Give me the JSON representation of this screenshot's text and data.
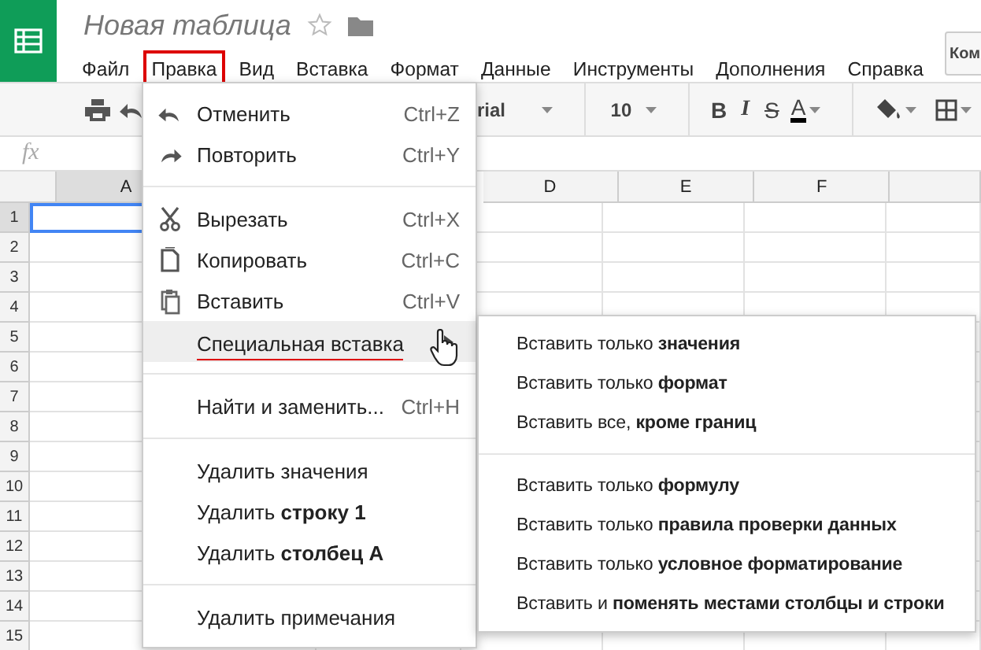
{
  "app": {
    "title": "Новая таблица",
    "starred": false
  },
  "menubar": [
    {
      "label": "Файл",
      "annotated": false
    },
    {
      "label": "Правка",
      "annotated": true
    },
    {
      "label": "Вид",
      "annotated": false
    },
    {
      "label": "Вставка",
      "annotated": false
    },
    {
      "label": "Формат",
      "annotated": false
    },
    {
      "label": "Данные",
      "annotated": false
    },
    {
      "label": "Инструменты",
      "annotated": false
    },
    {
      "label": "Дополнения",
      "annotated": false
    },
    {
      "label": "Справка",
      "annotated": false
    }
  ],
  "top_button": {
    "label": "Ком"
  },
  "toolbar": {
    "font": "rial",
    "font_size": "10",
    "format_buttons": [
      {
        "label": "B",
        "kind": "bold"
      },
      {
        "label": "I",
        "kind": "italic"
      },
      {
        "label": "S",
        "kind": "strike"
      },
      {
        "label": "A",
        "kind": "color"
      }
    ]
  },
  "formula_bar": {
    "label": "fx"
  },
  "columns": [
    {
      "label": "A",
      "selected": true
    },
    {
      "label": "D",
      "selected": false
    },
    {
      "label": "E",
      "selected": false
    },
    {
      "label": "F",
      "selected": false
    },
    {
      "selected": false
    }
  ],
  "rows": [
    {
      "label": "1",
      "selected": true
    },
    {
      "label": "2",
      "selected": false
    },
    {
      "label": "3",
      "selected": false
    },
    {
      "label": "4",
      "selected": false
    },
    {
      "label": "5",
      "selected": false
    },
    {
      "label": "6",
      "selected": false
    },
    {
      "label": "7",
      "selected": false
    },
    {
      "label": "8",
      "selected": false
    },
    {
      "label": "9",
      "selected": false
    },
    {
      "label": "10",
      "selected": false
    },
    {
      "label": "11",
      "selected": false
    },
    {
      "label": "12",
      "selected": false
    },
    {
      "label": "13",
      "selected": false
    },
    {
      "label": "14",
      "selected": false
    },
    {
      "label": "15",
      "selected": false
    }
  ],
  "edit_menu": [
    [
      {
        "label": "Отменить",
        "shortcut": "Ctrl+Z",
        "kind": "undo",
        "selected": false
      },
      {
        "label": "Повторить",
        "shortcut": "Ctrl+Y",
        "kind": "redo",
        "selected": false
      }
    ],
    [
      {
        "label": "Вырезать",
        "shortcut": "Ctrl+X",
        "kind": "cut",
        "selected": false
      },
      {
        "label": "Копировать",
        "shortcut": "Ctrl+C",
        "kind": "copy",
        "selected": false
      },
      {
        "label": "Вставить",
        "shortcut": "Ctrl+V",
        "kind": "paste",
        "selected": false
      },
      {
        "label": "Специальная вставка",
        "submenu": true,
        "selected": true,
        "annotated": true
      }
    ],
    [
      {
        "label": "Найти и заменить...",
        "shortcut": "Ctrl+H",
        "selected": false
      }
    ],
    [
      {
        "label": "Удалить значения",
        "selected": false
      },
      {
        "label": "Удалить **строку 1**",
        "selected": false
      },
      {
        "label": "Удалить **столбец A**",
        "selected": false
      }
    ],
    [
      {
        "label": "Удалить примечания",
        "selected": false
      }
    ]
  ],
  "paste_special_menu": [
    [
      "Вставить только **значения**",
      "Вставить только **формат**",
      "Вставить все, **кроме границ**"
    ],
    [
      "Вставить только **формулу**",
      "Вставить только **правила проверки данных**",
      "Вставить только **условное форматирование**",
      "Вставить и **поменять местами столбцы и строки**"
    ]
  ]
}
